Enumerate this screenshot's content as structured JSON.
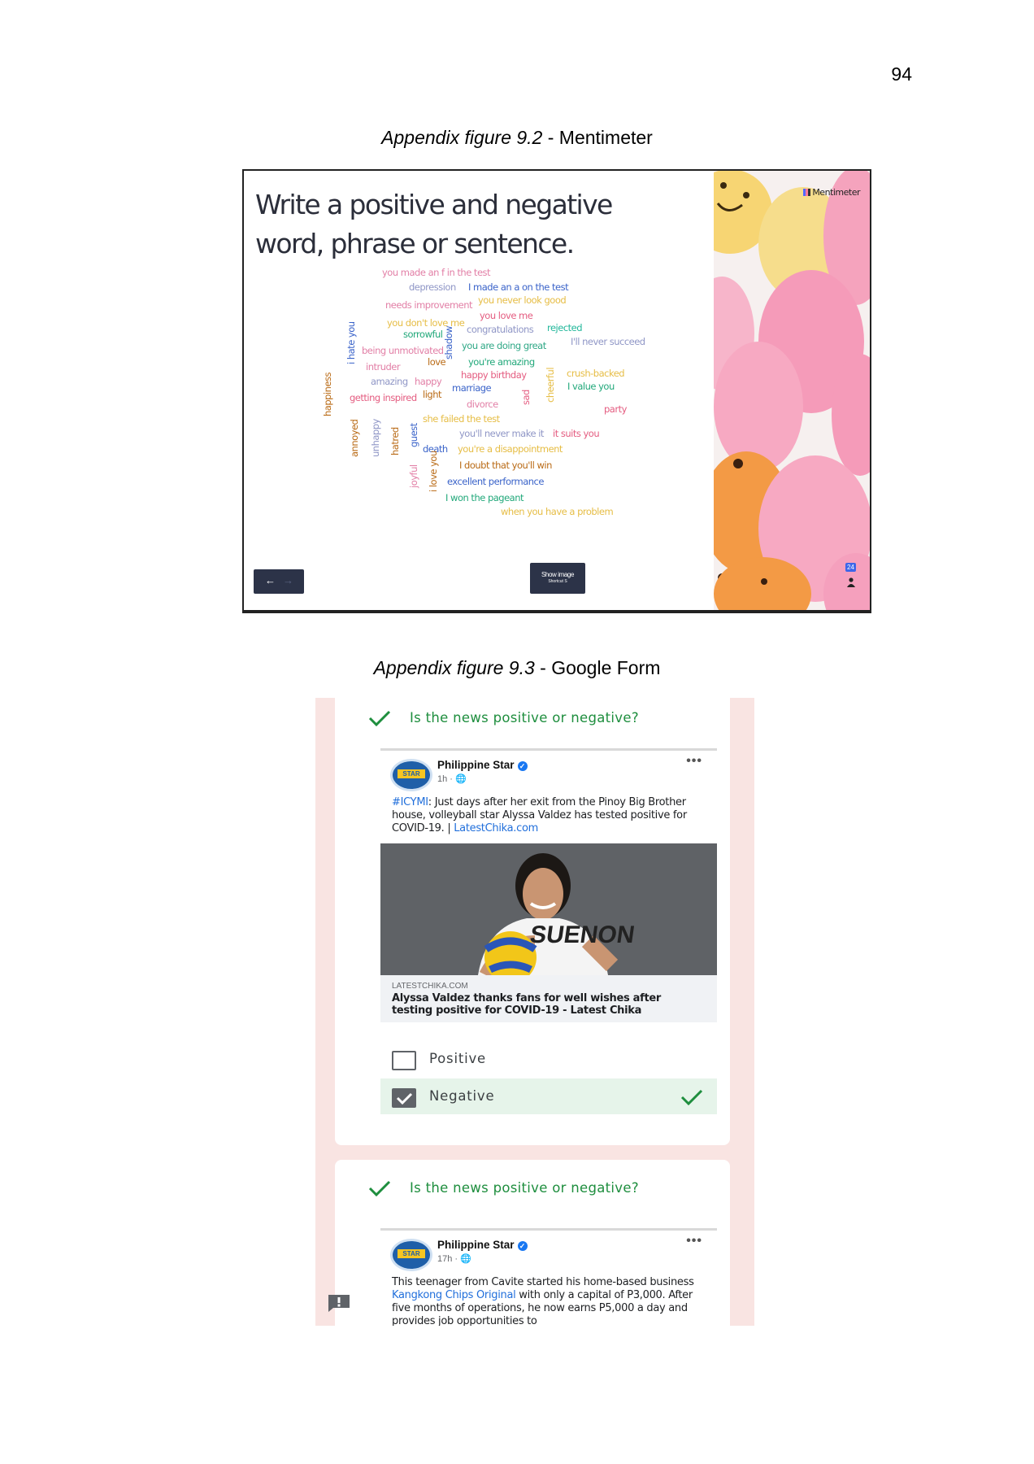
{
  "page_number": "94",
  "figures": [
    {
      "label": "Appendix figure 9.2",
      "title": " - Mentimeter"
    },
    {
      "label": "Appendix figure 9.3",
      "title": " - Google Form"
    }
  ],
  "mentimeter": {
    "title": "Write a positive and negative word, phrase or sentence.",
    "brand": "Mentimeter",
    "show_image_label": "Show image",
    "shortcut_label": "Shortcut S",
    "participant_count": "24",
    "words": [
      {
        "text": "you made an f in the test",
        "color": "#e27fa6"
      },
      {
        "text": "depression",
        "color": "#8f96c6"
      },
      {
        "text": "I made an a on the test",
        "color": "#3a63c9"
      },
      {
        "text": "needs improvement",
        "color": "#e27fa6"
      },
      {
        "text": "you never look good",
        "color": "#e6bd45"
      },
      {
        "text": "you love me",
        "color": "#e45c80"
      },
      {
        "text": "you don't love me",
        "color": "#e6bd45"
      },
      {
        "text": "congratulations",
        "color": "#8f96c6"
      },
      {
        "text": "rejected",
        "color": "#21b79a"
      },
      {
        "text": "sorrowful",
        "color": "#21a87a"
      },
      {
        "text": "you are doing great",
        "color": "#2fa886"
      },
      {
        "text": "I'll never succeed",
        "color": "#8f96c6"
      },
      {
        "text": "being unmotivated",
        "color": "#e27fa6"
      },
      {
        "text": "love",
        "color": "#b96a15"
      },
      {
        "text": "you're amazing",
        "color": "#21a87a"
      },
      {
        "text": "intruder",
        "color": "#e27fa6"
      },
      {
        "text": "happy birthday",
        "color": "#e45c80"
      },
      {
        "text": "crush-backed",
        "color": "#e6bd45"
      },
      {
        "text": "amazing",
        "color": "#8f96c6"
      },
      {
        "text": "happy",
        "color": "#e27fa6"
      },
      {
        "text": "marriage",
        "color": "#3a63c9"
      },
      {
        "text": "I value you",
        "color": "#21a87a"
      },
      {
        "text": "getting inspired",
        "color": "#e45c80"
      },
      {
        "text": "light",
        "color": "#b96a15"
      },
      {
        "text": "divorce",
        "color": "#e27fa6"
      },
      {
        "text": "party",
        "color": "#e45c80"
      },
      {
        "text": "she failed the test",
        "color": "#e6bd45"
      },
      {
        "text": "you'll never make it",
        "color": "#8f96c6"
      },
      {
        "text": "it suits you",
        "color": "#e45c80"
      },
      {
        "text": "death",
        "color": "#3a63c9"
      },
      {
        "text": "you're a disappointment",
        "color": "#e6bd45"
      },
      {
        "text": "I doubt that you'll win",
        "color": "#b96a15"
      },
      {
        "text": "excellent performance",
        "color": "#3a63c9"
      },
      {
        "text": "I won the pageant",
        "color": "#21a87a"
      },
      {
        "text": "when you have a problem",
        "color": "#e6bd45"
      },
      {
        "text": "happiness",
        "color": "#b96a15"
      },
      {
        "text": "i hate you",
        "color": "#3a63c9"
      },
      {
        "text": "shadow",
        "color": "#3a63c9"
      },
      {
        "text": "cheerful",
        "color": "#e6bd45"
      },
      {
        "text": "sad",
        "color": "#e45c80"
      },
      {
        "text": "annoyed",
        "color": "#b96a15"
      },
      {
        "text": "unhappy",
        "color": "#8f96c6"
      },
      {
        "text": "hatred",
        "color": "#b96a15"
      },
      {
        "text": "guest",
        "color": "#3a63c9"
      },
      {
        "text": "joyful",
        "color": "#e27fa6"
      },
      {
        "text": "i love you",
        "color": "#b96a15"
      }
    ]
  },
  "google_form": {
    "question": "Is the news positive or negative?",
    "post1": {
      "page_name": "Philippine Star",
      "avatar_text": "STAR",
      "meta": "1h · ",
      "text_hashtag": "#ICYMI",
      "text_body": ": Just days after her exit from the Pinoy Big Brother house, volleyball star Alyssa Valdez has tested positive for COVID-19.  | ",
      "text_link": "LatestChika.com",
      "link_domain": "LATESTCHIKA.COM",
      "link_title": "Alyssa Valdez thanks fans for well wishes after testing positive for COVID-19 - Latest Chika",
      "shirt_text": "SUENON",
      "options": [
        {
          "label": "Positive",
          "selected": false
        },
        {
          "label": "Negative",
          "selected": true
        }
      ]
    },
    "post2": {
      "page_name": "Philippine Star",
      "avatar_text": "STAR",
      "meta": "17h · ",
      "text_pre": "This teenager from Cavite started his home-based business ",
      "text_link": "Kangkong Chips Original",
      "text_post": " with only a capital of P3,000. After five months of operations, he now earns P5,000 a day and provides job opportunities to"
    }
  }
}
